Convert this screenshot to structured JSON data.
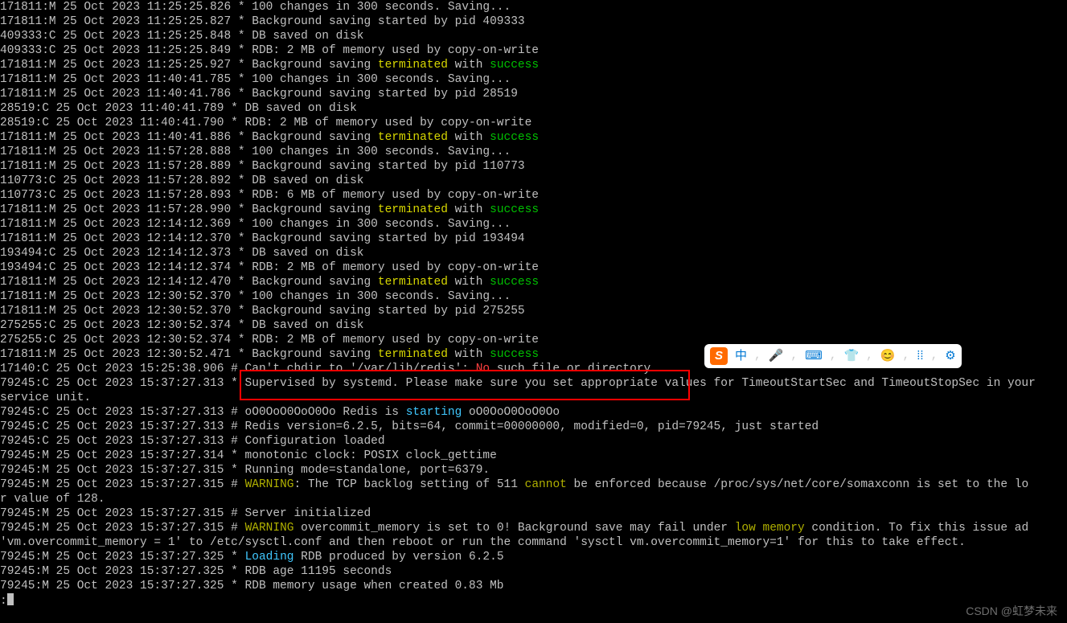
{
  "lines": [
    {
      "segs": [
        {
          "t": "171811:M 25 Oct 2023 11:25:25.826 * 100 changes in 300 seconds. Saving..."
        }
      ]
    },
    {
      "segs": [
        {
          "t": "171811:M 25 Oct 2023 11:25:25.827 * Background saving started by pid 409333"
        }
      ]
    },
    {
      "segs": [
        {
          "t": "409333:C 25 Oct 2023 11:25:25.848 * DB saved on disk"
        }
      ]
    },
    {
      "segs": [
        {
          "t": "409333:C 25 Oct 2023 11:25:25.849 * RDB: 2 MB of memory used by copy-on-write"
        }
      ]
    },
    {
      "segs": [
        {
          "t": "171811:M 25 Oct 2023 11:25:25.927 * Background saving "
        },
        {
          "t": "terminated",
          "c": "yellow"
        },
        {
          "t": " with "
        },
        {
          "t": "success",
          "c": "green"
        }
      ]
    },
    {
      "segs": [
        {
          "t": "171811:M 25 Oct 2023 11:40:41.785 * 100 changes in 300 seconds. Saving..."
        }
      ]
    },
    {
      "segs": [
        {
          "t": "171811:M 25 Oct 2023 11:40:41.786 * Background saving started by pid 28519"
        }
      ]
    },
    {
      "segs": [
        {
          "t": "28519:C 25 Oct 2023 11:40:41.789 * DB saved on disk"
        }
      ]
    },
    {
      "segs": [
        {
          "t": "28519:C 25 Oct 2023 11:40:41.790 * RDB: 2 MB of memory used by copy-on-write"
        }
      ]
    },
    {
      "segs": [
        {
          "t": "171811:M 25 Oct 2023 11:40:41.886 * Background saving "
        },
        {
          "t": "terminated",
          "c": "yellow"
        },
        {
          "t": " with "
        },
        {
          "t": "success",
          "c": "green"
        }
      ]
    },
    {
      "segs": [
        {
          "t": "171811:M 25 Oct 2023 11:57:28.888 * 100 changes in 300 seconds. Saving..."
        }
      ]
    },
    {
      "segs": [
        {
          "t": "171811:M 25 Oct 2023 11:57:28.889 * Background saving started by pid 110773"
        }
      ]
    },
    {
      "segs": [
        {
          "t": "110773:C 25 Oct 2023 11:57:28.892 * DB saved on disk"
        }
      ]
    },
    {
      "segs": [
        {
          "t": "110773:C 25 Oct 2023 11:57:28.893 * RDB: 6 MB of memory used by copy-on-write"
        }
      ]
    },
    {
      "segs": [
        {
          "t": "171811:M 25 Oct 2023 11:57:28.990 * Background saving "
        },
        {
          "t": "terminated",
          "c": "yellow"
        },
        {
          "t": " with "
        },
        {
          "t": "success",
          "c": "green"
        }
      ]
    },
    {
      "segs": [
        {
          "t": "171811:M 25 Oct 2023 12:14:12.369 * 100 changes in 300 seconds. Saving..."
        }
      ]
    },
    {
      "segs": [
        {
          "t": "171811:M 25 Oct 2023 12:14:12.370 * Background saving started by pid 193494"
        }
      ]
    },
    {
      "segs": [
        {
          "t": "193494:C 25 Oct 2023 12:14:12.373 * DB saved on disk"
        }
      ]
    },
    {
      "segs": [
        {
          "t": "193494:C 25 Oct 2023 12:14:12.374 * RDB: 2 MB of memory used by copy-on-write"
        }
      ]
    },
    {
      "segs": [
        {
          "t": "171811:M 25 Oct 2023 12:14:12.470 * Background saving "
        },
        {
          "t": "terminated",
          "c": "yellow"
        },
        {
          "t": " with "
        },
        {
          "t": "success",
          "c": "green"
        }
      ]
    },
    {
      "segs": [
        {
          "t": "171811:M 25 Oct 2023 12:30:52.370 * 100 changes in 300 seconds. Saving..."
        }
      ]
    },
    {
      "segs": [
        {
          "t": "171811:M 25 Oct 2023 12:30:52.370 * Background saving started by pid 275255"
        }
      ]
    },
    {
      "segs": [
        {
          "t": "275255:C 25 Oct 2023 12:30:52.374 * DB saved on disk"
        }
      ]
    },
    {
      "segs": [
        {
          "t": "275255:C 25 Oct 2023 12:30:52.374 * RDB: 2 MB of memory used by copy-on-write"
        }
      ]
    },
    {
      "segs": [
        {
          "t": "171811:M 25 Oct 2023 12:30:52.471 * Background saving "
        },
        {
          "t": "terminated",
          "c": "yellow"
        },
        {
          "t": " with "
        },
        {
          "t": "success",
          "c": "green"
        }
      ]
    },
    {
      "segs": [
        {
          "t": "17140:C 25 Oct 2023 15:25:38.906 # Can't chdir to '/var/lib/redis': "
        },
        {
          "t": "No",
          "c": "red"
        },
        {
          "t": " such file or directory"
        }
      ]
    },
    {
      "segs": [
        {
          "t": "79245:C 25 Oct 2023 15:37:27.313 * Supervised by systemd. Please make sure you set appropriate values for TimeoutStartSec and TimeoutStopSec in your "
        }
      ]
    },
    {
      "segs": [
        {
          "t": "service unit."
        }
      ]
    },
    {
      "segs": [
        {
          "t": "79245:C 25 Oct 2023 15:37:27.313 # oO0OoO0OoO0Oo Redis is "
        },
        {
          "t": "starting",
          "c": "cyan"
        },
        {
          "t": " oO0OoO0OoO0Oo"
        }
      ]
    },
    {
      "segs": [
        {
          "t": "79245:C 25 Oct 2023 15:37:27.313 # Redis version=6.2.5, bits=64, commit=00000000, modified=0, pid=79245, just started"
        }
      ]
    },
    {
      "segs": [
        {
          "t": "79245:C 25 Oct 2023 15:37:27.313 # Configuration loaded"
        }
      ]
    },
    {
      "segs": [
        {
          "t": "79245:M 25 Oct 2023 15:37:27.314 * monotonic clock: POSIX clock_gettime"
        }
      ]
    },
    {
      "segs": [
        {
          "t": "79245:M 25 Oct 2023 15:37:27.315 * Running mode=standalone, port=6379."
        }
      ]
    },
    {
      "segs": [
        {
          "t": "79245:M 25 Oct 2023 15:37:27.315 # "
        },
        {
          "t": "WARNING",
          "c": "olive"
        },
        {
          "t": ": The TCP backlog setting of 511 "
        },
        {
          "t": "cannot",
          "c": "olive"
        },
        {
          "t": " be enforced because /proc/sys/net/core/somaxconn is set to the lo"
        }
      ]
    },
    {
      "segs": [
        {
          "t": "r value of 128."
        }
      ]
    },
    {
      "segs": [
        {
          "t": "79245:M 25 Oct 2023 15:37:27.315 # Server initialized"
        }
      ]
    },
    {
      "segs": [
        {
          "t": "79245:M 25 Oct 2023 15:37:27.315 # "
        },
        {
          "t": "WARNING",
          "c": "olive"
        },
        {
          "t": " overcommit_memory is set to 0! Background save may fail under "
        },
        {
          "t": "low memory",
          "c": "olive"
        },
        {
          "t": " condition. To fix this issue ad"
        }
      ]
    },
    {
      "segs": [
        {
          "t": "'vm.overcommit_memory = 1' to /etc/sysctl.conf and then reboot or run the command 'sysctl vm.overcommit_memory=1' for this to take effect."
        }
      ]
    },
    {
      "segs": [
        {
          "t": "79245:M 25 Oct 2023 15:37:27.325 * "
        },
        {
          "t": "Loading",
          "c": "cyan"
        },
        {
          "t": " RDB produced by version 6.2.5"
        }
      ]
    },
    {
      "segs": [
        {
          "t": "79245:M 25 Oct 2023 15:37:27.325 * RDB age 11195 seconds"
        }
      ]
    },
    {
      "segs": [
        {
          "t": "79245:M 25 Oct 2023 15:37:27.325 * RDB memory usage when created 0.83 Mb"
        }
      ]
    }
  ],
  "prompt": ":",
  "ime": {
    "logo": "S",
    "items": [
      "中",
      "🎤",
      "⌨",
      "👕",
      "😊",
      "⁞⁞",
      "⚙"
    ],
    "separators": [
      ",",
      ",",
      ",",
      ",",
      ",",
      ",",
      ""
    ]
  },
  "watermark": "CSDN @虹梦未来"
}
